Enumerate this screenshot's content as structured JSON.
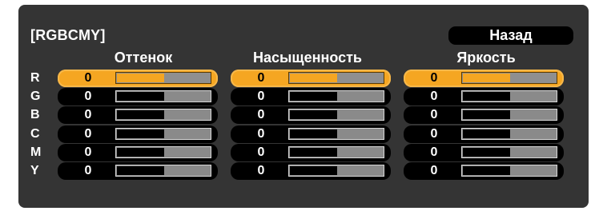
{
  "panel": {
    "title": "[RGBCMY]",
    "back_label": "Назад"
  },
  "columns": [
    {
      "label": "Оттенок"
    },
    {
      "label": "Насыщенность"
    },
    {
      "label": "Яркость"
    }
  ],
  "rows": [
    {
      "label": "R",
      "values": [
        "0",
        "0",
        "0"
      ],
      "selected": true
    },
    {
      "label": "G",
      "values": [
        "0",
        "0",
        "0"
      ],
      "selected": false
    },
    {
      "label": "B",
      "values": [
        "0",
        "0",
        "0"
      ],
      "selected": false
    },
    {
      "label": "C",
      "values": [
        "0",
        "0",
        "0"
      ],
      "selected": false
    },
    {
      "label": "M",
      "values": [
        "0",
        "0",
        "0"
      ],
      "selected": false
    },
    {
      "label": "Y",
      "values": [
        "0",
        "0",
        "0"
      ],
      "selected": false
    }
  ],
  "slider": {
    "level_fraction": 0.5
  },
  "colors": {
    "panel_bg": "#343434",
    "selected_accent": "#f5a622",
    "control_bg": "#000000",
    "track_gray": "#8a8a8a"
  }
}
